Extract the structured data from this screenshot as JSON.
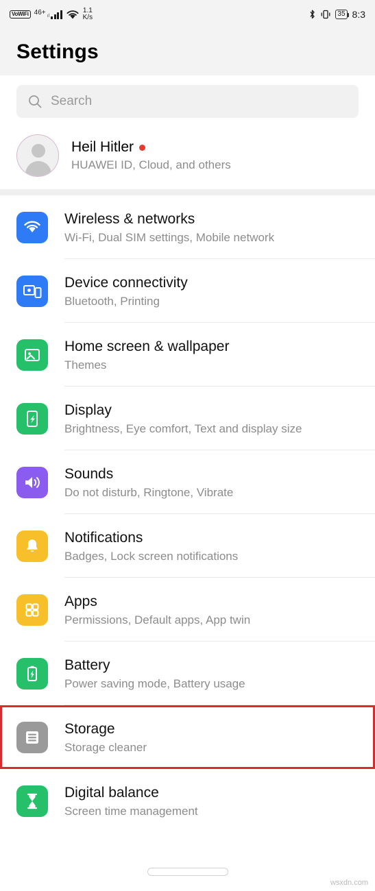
{
  "status_bar": {
    "volte": "VoWiFi",
    "network": "46+",
    "network_sub": "ıl",
    "speed_value": "1.1",
    "speed_unit": "K/s",
    "battery": "35",
    "clock": "8:3"
  },
  "header": {
    "title": "Settings"
  },
  "search": {
    "placeholder": "Search",
    "icon": "search-icon"
  },
  "account": {
    "name": "Heil Hitler",
    "subtitle": "HUAWEI ID, Cloud, and others",
    "has_notification_dot": true
  },
  "settings_items": [
    {
      "label": "Wireless & networks",
      "sub": "Wi-Fi, Dual SIM settings, Mobile network",
      "icon": "wifi-icon",
      "icon_color": "#2f7bf6",
      "highlighted": false
    },
    {
      "label": "Device connectivity",
      "sub": "Bluetooth, Printing",
      "icon": "device-connectivity-icon",
      "icon_color": "#2f7bf6",
      "highlighted": false
    },
    {
      "label": "Home screen & wallpaper",
      "sub": "Themes",
      "icon": "wallpaper-icon",
      "icon_color": "#27c06a",
      "highlighted": false
    },
    {
      "label": "Display",
      "sub": "Brightness, Eye comfort, Text and display size",
      "icon": "display-icon",
      "icon_color": "#27c06a",
      "highlighted": false
    },
    {
      "label": "Sounds",
      "sub": "Do not disturb, Ringtone, Vibrate",
      "icon": "sounds-icon",
      "icon_color": "#8b5cf0",
      "highlighted": false
    },
    {
      "label": "Notifications",
      "sub": "Badges, Lock screen notifications",
      "icon": "bell-icon",
      "icon_color": "#f7c02b",
      "highlighted": false
    },
    {
      "label": "Apps",
      "sub": "Permissions, Default apps, App twin",
      "icon": "apps-grid-icon",
      "icon_color": "#f7c02b",
      "highlighted": false
    },
    {
      "label": "Battery",
      "sub": "Power saving mode, Battery usage",
      "icon": "battery-icon",
      "icon_color": "#27c06a",
      "highlighted": false
    },
    {
      "label": "Storage",
      "sub": "Storage cleaner",
      "icon": "storage-icon",
      "icon_color": "#9a9a9a",
      "highlighted": true
    },
    {
      "label": "Digital balance",
      "sub": "Screen time management",
      "icon": "hourglass-icon",
      "icon_color": "#27c06a",
      "highlighted": false
    }
  ],
  "highlight_color": "#d42d2d",
  "watermark": "wsxdn.com"
}
